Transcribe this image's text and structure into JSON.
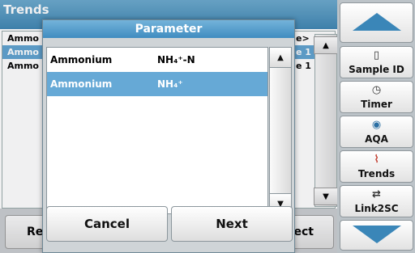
{
  "background": {
    "title": "Trends",
    "rows": [
      {
        "left": "Ammo",
        "right": "e>"
      },
      {
        "left": "Ammo",
        "right": "e 1"
      },
      {
        "left": "Ammo",
        "right": "e 1"
      }
    ],
    "bottom_left": "Re",
    "bottom_right": "ect"
  },
  "sidebar": {
    "buttons": [
      {
        "label": "",
        "icon": "arrow-up"
      },
      {
        "label": "Sample ID",
        "icon": "vial"
      },
      {
        "label": "Timer",
        "icon": "clock"
      },
      {
        "label": "AQA",
        "icon": "quality"
      },
      {
        "label": "Trends",
        "icon": "chart"
      },
      {
        "label": "Link2SC",
        "icon": "link"
      },
      {
        "label": "",
        "icon": "arrow-down"
      }
    ]
  },
  "dialog": {
    "title": "Parameter",
    "items": [
      {
        "name": "Ammonium",
        "formula": "NH₄⁺-N",
        "selected": false
      },
      {
        "name": "Ammonium",
        "formula": "NH₄⁺",
        "selected": true
      }
    ],
    "cancel_label": "Cancel",
    "next_label": "Next"
  },
  "colors": {
    "accent": "#3f8cc0",
    "selection": "#66a9d6"
  }
}
